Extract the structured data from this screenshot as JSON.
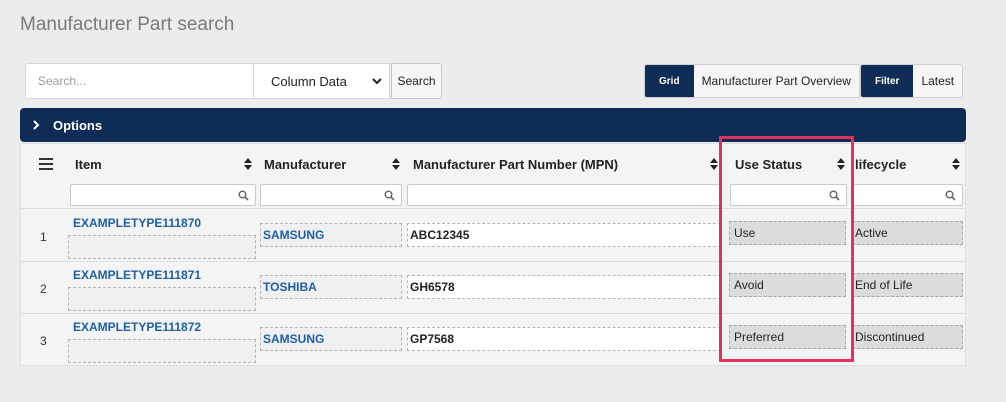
{
  "page": {
    "title": "Manufacturer Part search"
  },
  "toolbar": {
    "search_placeholder": "Search...",
    "column_select_value": "Column Data",
    "search_button": "Search",
    "view_grid": "Grid",
    "view_overview": "Manufacturer Part Overview",
    "filter": "Filter",
    "latest": "Latest"
  },
  "options": {
    "label": "Options"
  },
  "table": {
    "headers": {
      "item": "Item",
      "manufacturer": "Manufacturer",
      "mpn": "Manufacturer Part Number (MPN)",
      "use_status": "Use Status",
      "lifecycle": "lifecycle"
    },
    "rows": [
      {
        "num": "1",
        "item": "EXAMPLETYPE111870",
        "manufacturer": "SAMSUNG",
        "mpn": "ABC12345",
        "use_status": "Use",
        "lifecycle": "Active"
      },
      {
        "num": "2",
        "item": "EXAMPLETYPE111871",
        "manufacturer": "TOSHIBA",
        "mpn": "GH6578",
        "use_status": "Avoid",
        "lifecycle": "End of Life"
      },
      {
        "num": "3",
        "item": "EXAMPLETYPE111872",
        "manufacturer": "SAMSUNG",
        "mpn": "GP7568",
        "use_status": "Preferred",
        "lifecycle": "Discontinued"
      }
    ]
  },
  "colors": {
    "navy": "#0e2c56",
    "link": "#1e5fa6",
    "highlight": "#e2315a"
  },
  "icons": {
    "menu": "hamburger-icon",
    "sort": "sort-icon",
    "search": "magnifier-icon",
    "expand": "chevron-right-icon",
    "dropdown": "chevron-down-icon"
  }
}
